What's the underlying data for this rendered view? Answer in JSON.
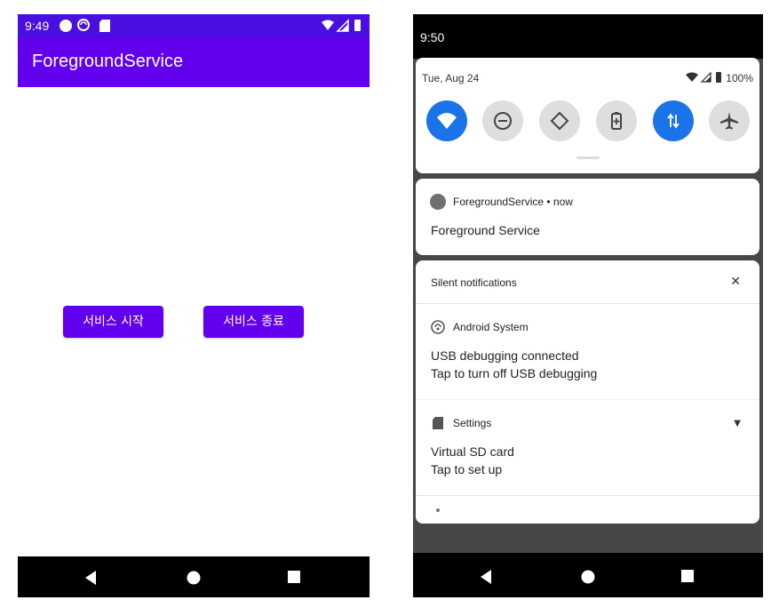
{
  "left": {
    "status_bar": {
      "time": "9:49"
    },
    "app_bar": {
      "title": "ForegroundService"
    },
    "buttons": {
      "start": "서비스 시작",
      "stop": "서비스 종료"
    }
  },
  "right": {
    "status_bar": {
      "time": "9:50"
    },
    "quick_settings": {
      "date": "Tue, Aug 24",
      "battery": "100%",
      "tiles": [
        "wifi",
        "do-not-disturb",
        "auto-rotate",
        "battery-saver",
        "mobile-data",
        "airplane-mode"
      ]
    },
    "foreground_notification": {
      "app": "ForegroundService • now",
      "text": "Foreground Service"
    },
    "silent": {
      "header": "Silent notifications",
      "android_system": {
        "app": "Android System",
        "title": "USB debugging connected",
        "text": "Tap to turn off USB debugging"
      },
      "settings": {
        "app": "Settings",
        "title": "Virtual SD card",
        "text": "Tap to set up"
      }
    }
  },
  "colors": {
    "primary": "#6200ee",
    "status_bar": "#4a0fe0",
    "qs_active": "#1a73e8"
  }
}
